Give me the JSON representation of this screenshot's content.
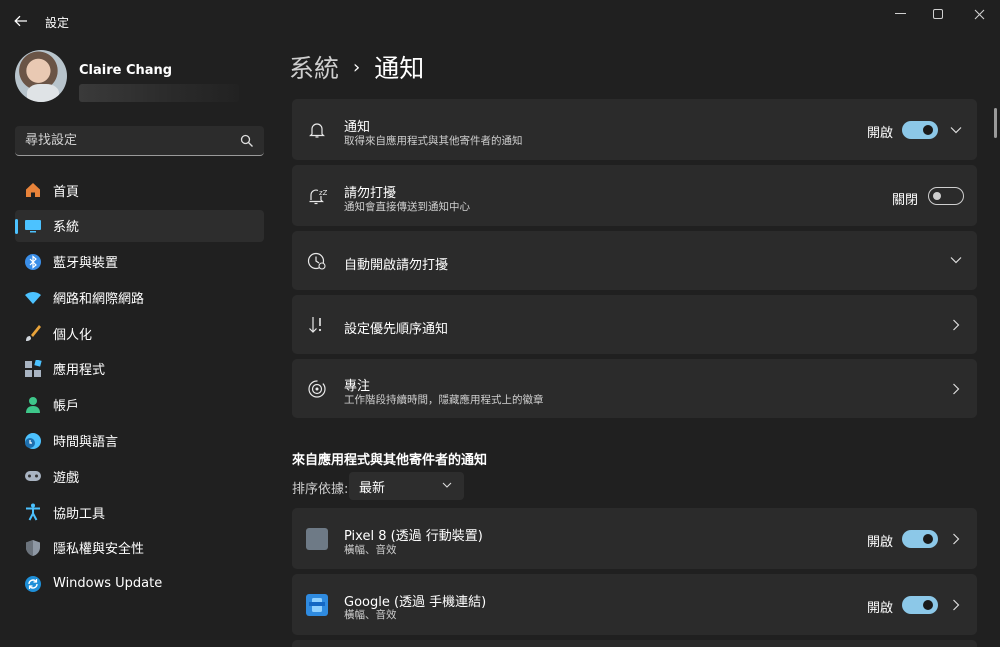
{
  "window": {
    "app_title": "設定",
    "controls": {
      "minimize": "minimize-icon",
      "maximize": "maximize-icon",
      "close": "close-icon"
    }
  },
  "profile": {
    "name": "Claire Chang"
  },
  "search": {
    "placeholder": "尋找設定"
  },
  "sidebar": {
    "items": [
      {
        "label": "首頁",
        "icon": "home-icon",
        "color": "#e8833a"
      },
      {
        "label": "系統",
        "icon": "system-icon",
        "color": "#4cc2ff",
        "selected": true
      },
      {
        "label": "藍牙與裝置",
        "icon": "bluetooth-icon",
        "color": "#3a8ee8"
      },
      {
        "label": "網路和網際網路",
        "icon": "wifi-icon",
        "color": "#4cc2ff"
      },
      {
        "label": "個人化",
        "icon": "brush-icon",
        "color": "#e8a33a"
      },
      {
        "label": "應用程式",
        "icon": "apps-icon",
        "color": "#a9b4c2"
      },
      {
        "label": "帳戶",
        "icon": "account-icon",
        "color": "#3ec78a"
      },
      {
        "label": "時間與語言",
        "icon": "clock-globe-icon",
        "color": "#4cc2ff"
      },
      {
        "label": "遊戲",
        "icon": "gamepad-icon",
        "color": "#a9b4c2"
      },
      {
        "label": "協助工具",
        "icon": "accessibility-icon",
        "color": "#4cc2ff"
      },
      {
        "label": "隱私權與安全性",
        "icon": "shield-icon",
        "color": "#8e98a4"
      },
      {
        "label": "Windows Update",
        "icon": "update-icon",
        "color": "#4cc2ff"
      }
    ]
  },
  "breadcrumb": {
    "parent": "系統",
    "separator": "›",
    "current": "通知"
  },
  "settings": [
    {
      "title": "通知",
      "subtitle": "取得來自應用程式與其他寄件者的通知",
      "state": "開啟",
      "toggle_on": true,
      "icon": "bell-icon"
    },
    {
      "title": "請勿打擾",
      "subtitle": "通知會直接傳送到通知中心",
      "state": "關閉",
      "toggle_on": false,
      "icon": "bell-snooze-icon"
    },
    {
      "title": "自動開啟請勿打擾",
      "icon": "clock-icon"
    },
    {
      "title": "設定優先順序通知",
      "icon": "sort-arrows-icon"
    },
    {
      "title": "專注",
      "subtitle": "工作階段持續時間，隱藏應用程式上的徽章",
      "icon": "focus-icon"
    }
  ],
  "apps_section": {
    "title": "來自應用程式與其他寄件者的通知",
    "sort_label": "排序依據:",
    "sort_value": "最新",
    "apps": [
      {
        "title": "Pixel 8 (透過 行動裝置)",
        "subtitle": "橫幅、音效",
        "state": "開啟",
        "toggle_on": true,
        "icon_color": "#6e7a86"
      },
      {
        "title": "Google (透過 手機連結)",
        "subtitle": "橫幅、音效",
        "state": "開啟",
        "toggle_on": true,
        "icon_color": "#2f8be0"
      }
    ]
  }
}
